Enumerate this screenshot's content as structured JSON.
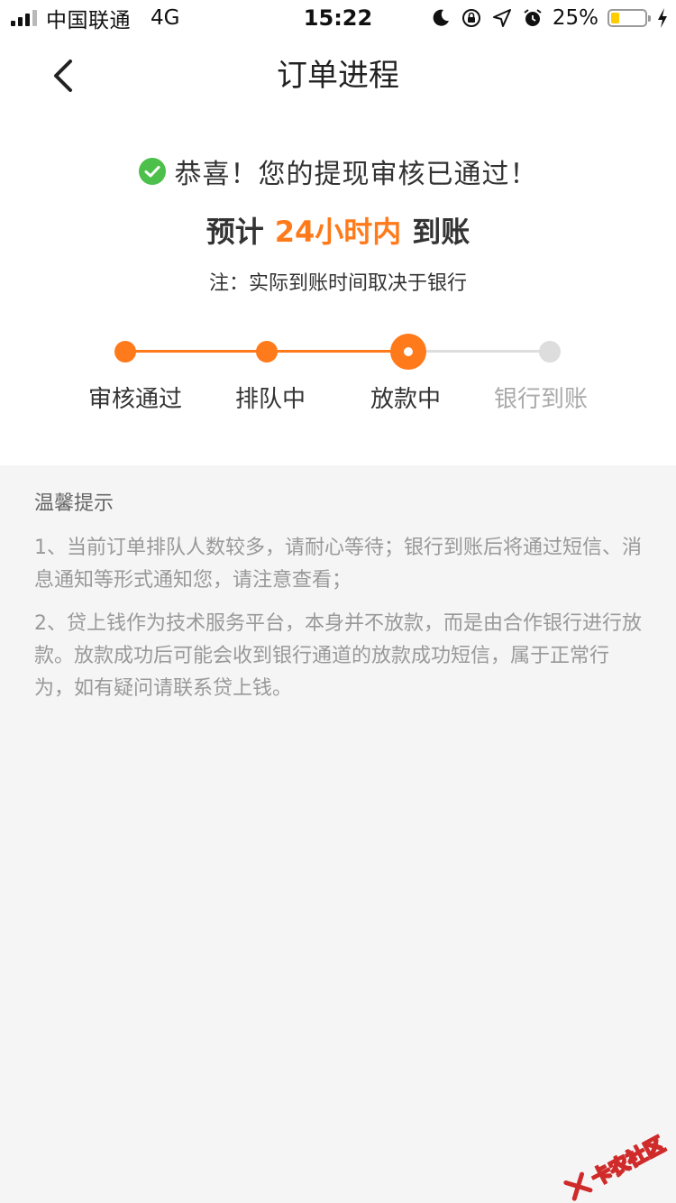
{
  "status_bar": {
    "carrier": "中国联通",
    "network": "4G",
    "time": "15:22",
    "battery_percent": "25%",
    "battery_level": 0.25,
    "icons": [
      "signal-icon",
      "moon-icon",
      "rotation-lock-icon",
      "location-icon",
      "alarm-icon",
      "battery-icon",
      "charging-icon"
    ]
  },
  "nav": {
    "title": "订单进程",
    "back_icon": "chevron-left-icon"
  },
  "result": {
    "success_text": "恭喜！您的提现审核已通过！",
    "eta_prefix": "预计",
    "eta_highlight": "24小时内",
    "eta_suffix": "到账",
    "note": "注：实际到账时间取决于银行"
  },
  "progress": {
    "current_index": 2,
    "steps": [
      {
        "label": "审核通过",
        "state": "done"
      },
      {
        "label": "排队中",
        "state": "done"
      },
      {
        "label": "放款中",
        "state": "current"
      },
      {
        "label": "银行到账",
        "state": "todo"
      }
    ]
  },
  "tips": {
    "title": "温馨提示",
    "items": [
      "1、当前订单排队人数较多，请耐心等待；银行到账后将通过短信、消息通知等形式通知您，请注意查看；",
      "2、贷上钱作为技术服务平台，本身并不放款，而是由合作银行进行放款。放款成功后可能会收到银行通道的放款成功短信，属于正常行为，如有疑问请联系贷上钱。"
    ]
  },
  "watermark": {
    "text": "卡农社区"
  },
  "colors": {
    "accent": "#ff7a1a",
    "success": "#4cc04a",
    "inactive": "#dddddd",
    "background": "#f5f5f5"
  }
}
